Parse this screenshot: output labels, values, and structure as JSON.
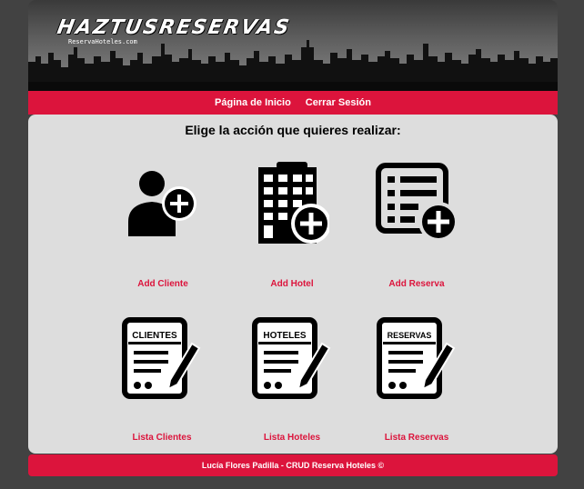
{
  "header": {
    "logo_title": "HAZTUSRESERVAS",
    "logo_subtitle": "ReservaHoteles.com"
  },
  "nav": {
    "items": [
      {
        "label": "Página de Inicio"
      },
      {
        "label": "Cerrar Sesión"
      }
    ]
  },
  "main": {
    "heading": "Elige la acción que quieres realizar:",
    "actions": [
      {
        "label": "Add Cliente",
        "icon": "add-user-icon"
      },
      {
        "label": "Add Hotel",
        "icon": "add-hotel-icon"
      },
      {
        "label": "Add Reserva",
        "icon": "add-list-icon"
      },
      {
        "label": "Lista Clientes",
        "icon": "document-edit-icon",
        "doc_title": "CLIENTES"
      },
      {
        "label": "Lista Hoteles",
        "icon": "document-edit-icon",
        "doc_title": "HOTELES"
      },
      {
        "label": "Lista Reservas",
        "icon": "document-edit-icon",
        "doc_title": "RESERVAS"
      }
    ]
  },
  "footer": {
    "text": "Lucía Flores Padilla - CRUD Reserva Hoteles ©"
  },
  "colors": {
    "accent": "#dc143c",
    "content_bg": "#dddddd",
    "page_bg": "#424242"
  }
}
